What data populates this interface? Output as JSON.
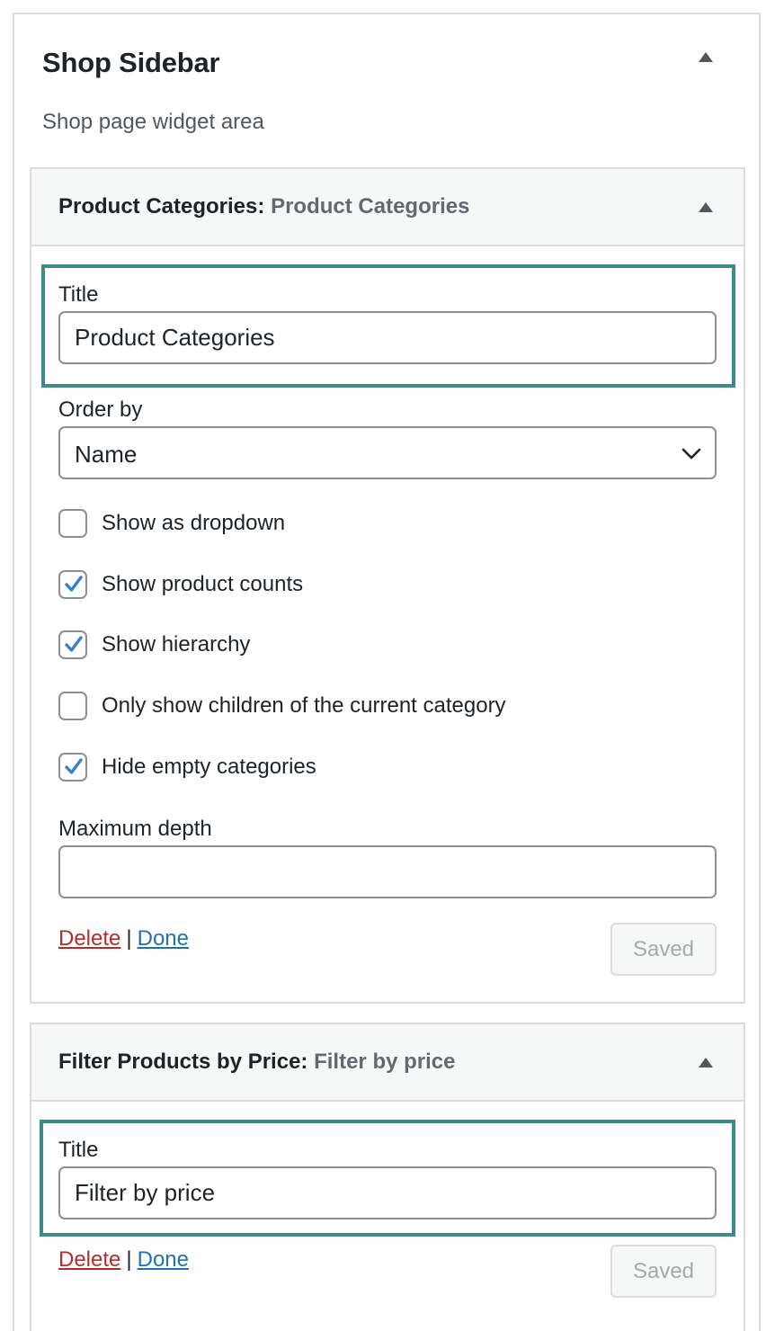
{
  "sidebar": {
    "title": "Shop Sidebar",
    "description": "Shop page widget area"
  },
  "widgets": [
    {
      "type": "Product Categories",
      "separator": ":",
      "instance_title": "Product Categories",
      "title_label": "Title",
      "title_value": "Product Categories",
      "order_by_label": "Order by",
      "order_by_value": "Name",
      "checkboxes": [
        {
          "label": "Show as dropdown",
          "checked": false
        },
        {
          "label": "Show product counts",
          "checked": true
        },
        {
          "label": "Show hierarchy",
          "checked": true
        },
        {
          "label": "Only show children of the current category",
          "checked": false
        },
        {
          "label": "Hide empty categories",
          "checked": true
        }
      ],
      "max_depth_label": "Maximum depth",
      "max_depth_value": "",
      "delete_label": "Delete",
      "divider": "|",
      "done_label": "Done",
      "saved_label": "Saved"
    },
    {
      "type": "Filter Products by Price",
      "separator": ":",
      "instance_title": "Filter by price",
      "title_label": "Title",
      "title_value": "Filter by price",
      "delete_label": "Delete",
      "divider": "|",
      "done_label": "Done",
      "saved_label": "Saved"
    }
  ],
  "colors": {
    "highlight": "#3c8c88",
    "delete_link": "#b32d2e",
    "done_link": "#2271b1",
    "checkmark": "#3582c4"
  },
  "icons": {
    "collapse": "caret-up-icon",
    "select": "chevron-down-icon",
    "check": "checkmark-icon"
  }
}
